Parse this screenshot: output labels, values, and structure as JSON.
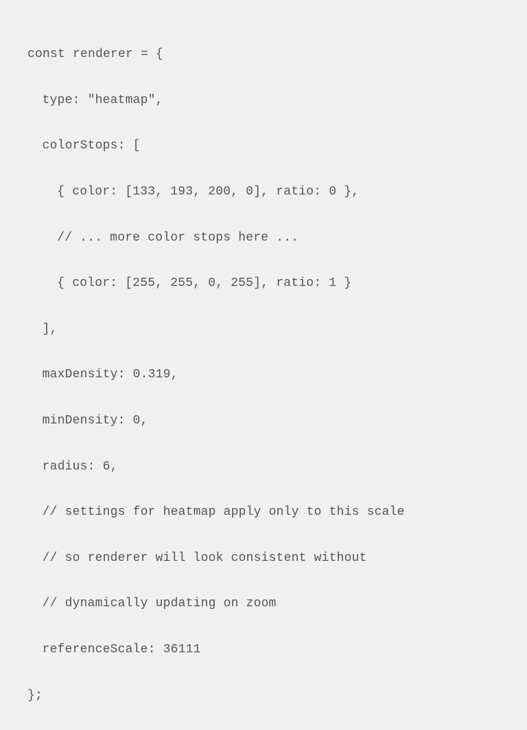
{
  "code": {
    "l1": "const renderer = {",
    "l2": "type: \"heatmap\",",
    "l3": "colorStops: [",
    "l4": "{ color: [133, 193, 200, 0], ratio: 0 },",
    "l5": "// ... more color stops here ...",
    "l6": "{ color: [255, 255, 0, 255], ratio: 1 }",
    "l7": "],",
    "l8": "maxDensity: 0.319,",
    "l9": "minDensity: 0,",
    "l10": "radius: 6,",
    "l11": "// settings for heatmap apply only to this scale",
    "l12": "// so renderer will look consistent without",
    "l13": "// dynamically updating on zoom",
    "l14": "referenceScale: 36111",
    "l15": "};"
  }
}
